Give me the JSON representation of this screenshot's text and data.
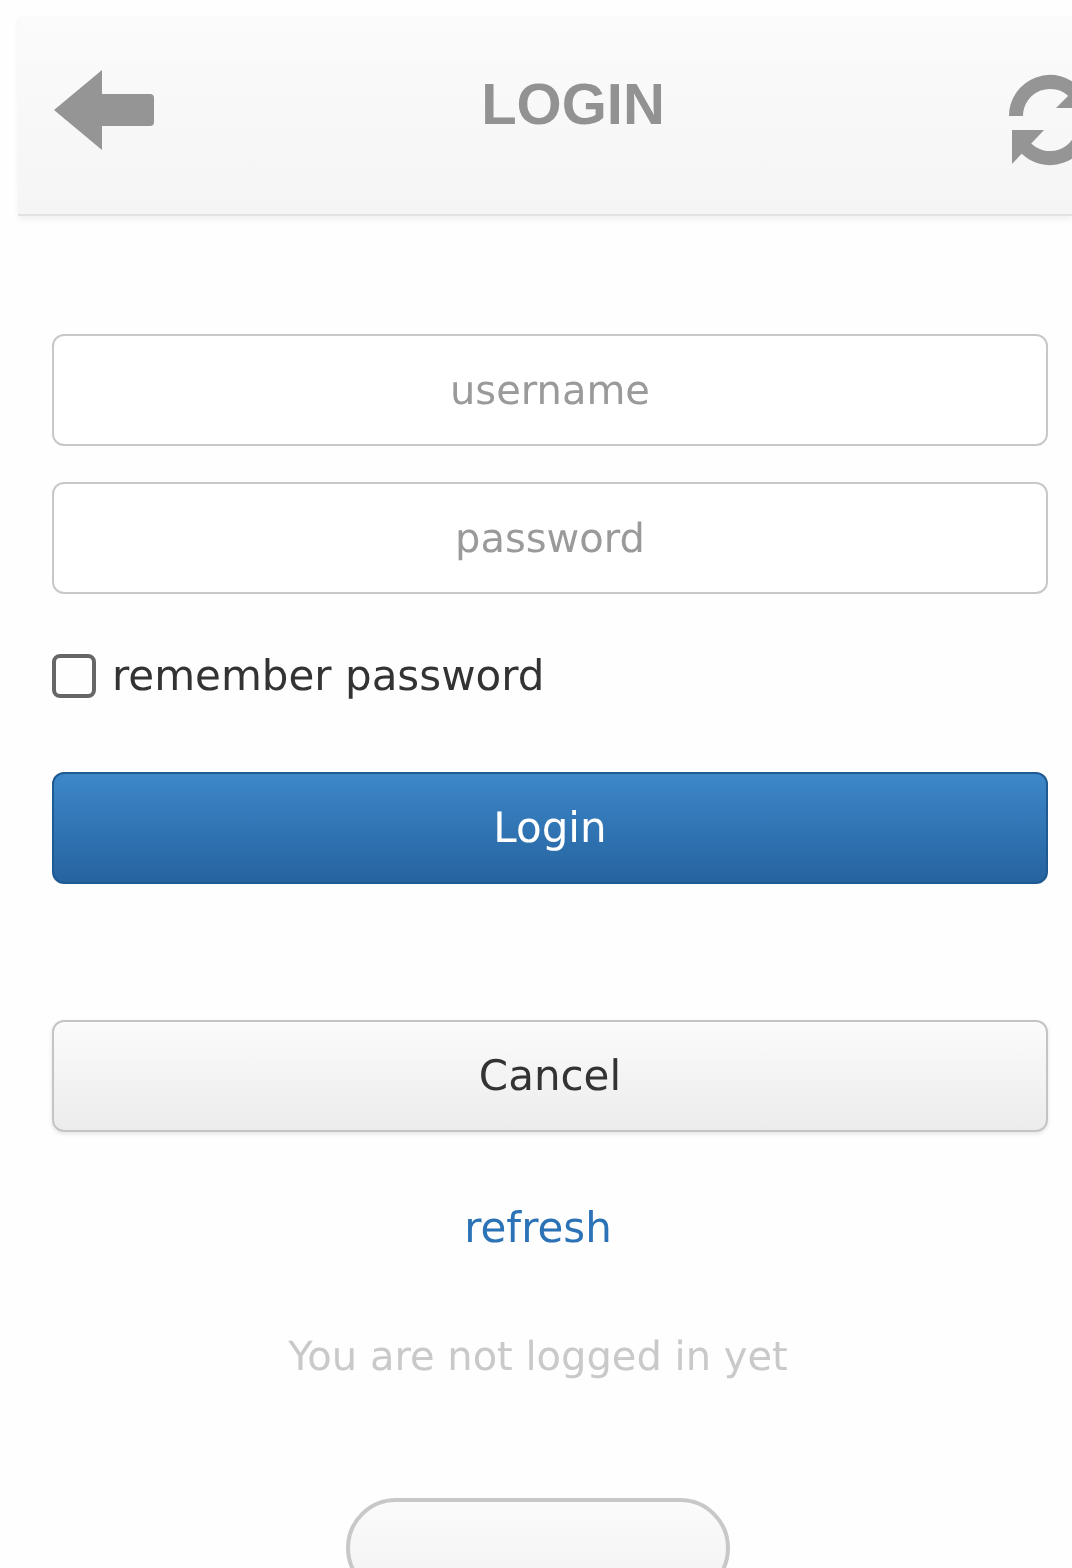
{
  "header": {
    "title": "LOGIN"
  },
  "fields": [
    {
      "placeholder": "username"
    },
    {
      "placeholder": "password"
    }
  ],
  "remember": {
    "label": "remember password",
    "checked": false
  },
  "buttons": [
    {
      "kind": "primary",
      "label": "Login"
    },
    {
      "kind": "secondary",
      "label": "Cancel"
    }
  ],
  "refresh_link": "refresh",
  "status": "You are not logged in yet"
}
